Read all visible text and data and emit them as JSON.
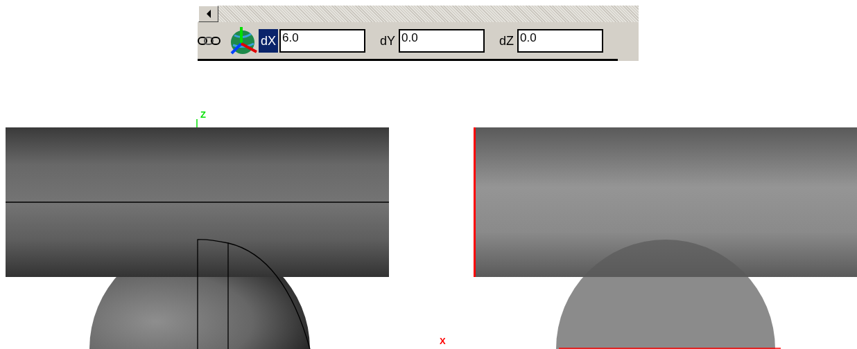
{
  "toolbar": {
    "fields": [
      {
        "label": "dX",
        "value": "6.0",
        "selected": true
      },
      {
        "label": "dY",
        "value": "0.0",
        "selected": false
      },
      {
        "label": "dZ",
        "value": "0.0",
        "selected": false
      }
    ]
  },
  "viewport": {
    "axis_labels": [
      {
        "text": "Z",
        "color": "#00e000"
      },
      {
        "text": "X",
        "color": "#ff0000"
      }
    ]
  }
}
